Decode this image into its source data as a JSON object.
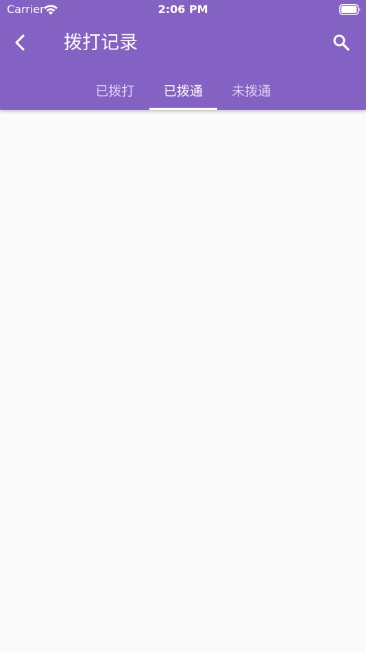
{
  "status_bar": {
    "carrier": "Carrier",
    "time": "2:06 PM"
  },
  "toolbar": {
    "title": "拨打记录",
    "back_icon": "chevron-left-icon",
    "search_icon": "search-icon"
  },
  "tabs": [
    {
      "label": "已拨打",
      "active": false
    },
    {
      "label": "已拨通",
      "active": true
    },
    {
      "label": "未拨通",
      "active": false
    }
  ],
  "colors": {
    "primary": "#8462c3",
    "background": "#fafafa",
    "on_primary": "#ffffff"
  }
}
